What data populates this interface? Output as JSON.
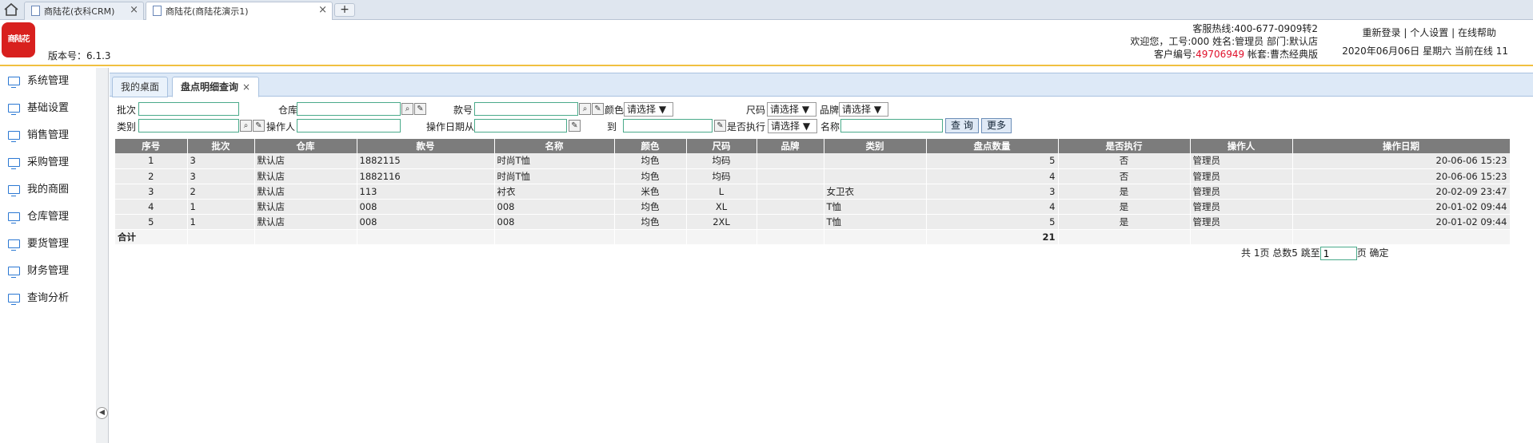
{
  "browser": {
    "tabs": [
      {
        "label": "商陆花(衣科CRM)",
        "active": false
      },
      {
        "label": "商陆花(商陆花演示1)",
        "active": true
      }
    ],
    "new_tab": "+",
    "close": "×"
  },
  "header": {
    "logo_text": "商陆花",
    "version": "版本号：6.1.3",
    "hotline": "客服热线:400-677-0909转2",
    "welcome": "欢迎您，工号:000 姓名:管理员 部门:默认店",
    "customer_prefix": "客户编号:",
    "customer_no": "49706949",
    "account": " 帐套:曹杰经典版",
    "links": [
      "重新登录",
      "个人设置",
      "在线帮助"
    ],
    "separator": "|",
    "datetime": "2020年06月06日 星期六 当前在线 11"
  },
  "sidebar": {
    "items": [
      "系统管理",
      "基础设置",
      "销售管理",
      "采购管理",
      "我的商圈",
      "仓库管理",
      "要货管理",
      "财务管理",
      "查询分析"
    ]
  },
  "page_tabs": [
    {
      "label": "我的桌面",
      "active": false
    },
    {
      "label": "盘点明细查询",
      "active": true,
      "close": "×"
    }
  ],
  "filters": {
    "batch": "批次",
    "warehouse": "仓库",
    "style_no": "款号",
    "color": "颜色",
    "color_select": "请选择 ▼",
    "size": "尺码",
    "size_select": "请选择 ▼",
    "brand": "品牌",
    "brand_select": "请选择 ▼",
    "category": "类别",
    "operator": "操作人",
    "date_from": "操作日期从",
    "date_to": "到",
    "executed": "是否执行",
    "executed_select": "请选择 ▼",
    "name": "名称",
    "query_btn": "查 询",
    "more_btn": "更多"
  },
  "table": {
    "columns": [
      "序号",
      "批次",
      "仓库",
      "款号",
      "名称",
      "颜色",
      "尺码",
      "品牌",
      "类别",
      "盘点数量",
      "是否执行",
      "操作人",
      "操作日期"
    ],
    "rows": [
      [
        "1",
        "3",
        "默认店",
        "1882115",
        "时尚T恤",
        "均色",
        "均码",
        "",
        "",
        "5",
        "否",
        "管理员",
        "20-06-06 15:23"
      ],
      [
        "2",
        "3",
        "默认店",
        "1882116",
        "时尚T恤",
        "均色",
        "均码",
        "",
        "",
        "4",
        "否",
        "管理员",
        "20-06-06 15:23"
      ],
      [
        "3",
        "2",
        "默认店",
        "113",
        "衬衣",
        "米色",
        "L",
        "",
        "女卫衣",
        "3",
        "是",
        "管理员",
        "20-02-09 23:47"
      ],
      [
        "4",
        "1",
        "默认店",
        "008",
        "008",
        "均色",
        "XL",
        "",
        "T恤",
        "4",
        "是",
        "管理员",
        "20-01-02 09:44"
      ],
      [
        "5",
        "1",
        "默认店",
        "008",
        "008",
        "均色",
        "2XL",
        "",
        "T恤",
        "5",
        "是",
        "管理员",
        "20-01-02 09:44"
      ]
    ],
    "total_label": "合计",
    "total_qty": "21"
  },
  "pager": {
    "text1": "共 1页 总数5 跳至",
    "page_value": "1",
    "text2": "页 确定"
  }
}
